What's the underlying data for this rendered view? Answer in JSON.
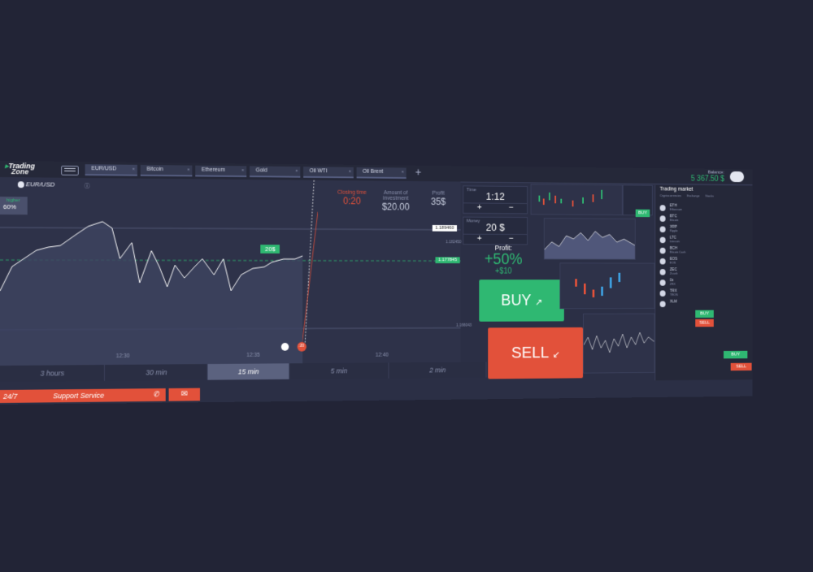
{
  "app": {
    "logo_line1": "Trading",
    "logo_line2": "Zone"
  },
  "tabs": [
    "EUR/USD",
    "Bitcoin",
    "Ethereum",
    "Gold",
    "Oil WTI",
    "Oil Brent"
  ],
  "balance": {
    "label": "Balance:",
    "value": "5 367.50 $"
  },
  "chart": {
    "pair": "EUR/USD",
    "direction_label": "higher",
    "direction_pct": "60%",
    "price_tags": [
      "1.189460",
      "1.182450",
      "1.177845",
      "1.166043"
    ],
    "marker": "20$",
    "time_labels": [
      "12:30",
      "12:35",
      "12:40"
    ],
    "countdown": ":20"
  },
  "stats": {
    "closing_label": "Closing time",
    "closing_value": "0:20",
    "investment_label": "Amount of investment",
    "investment_value": "$20.00",
    "profit_label": "Profit",
    "profit_value": "35$"
  },
  "controls": {
    "time_label": "Time",
    "time_value": "1:12",
    "money_label": "Money",
    "money_value": "20 $",
    "plus": "+",
    "minus": "−"
  },
  "profit": {
    "label": "Profit:",
    "percent": "+50%",
    "amount": "+$10"
  },
  "actions": {
    "buy": "BUY",
    "sell": "SELL"
  },
  "timeline": [
    "3 hours",
    "30 min",
    "15 min",
    "5 min",
    "2 min"
  ],
  "support": {
    "hours": "24/7",
    "label": "Support Service"
  },
  "market": {
    "title": "Trading market",
    "subtabs": [
      "Cryptocurrencies",
      "Exchange",
      "Stocks"
    ],
    "coins": [
      {
        "name": "ETH",
        "sub": "Ethereum"
      },
      {
        "name": "BTC",
        "sub": "Bitcoin"
      },
      {
        "name": "XRP",
        "sub": "Ripple"
      },
      {
        "name": "LTC",
        "sub": "Litecoin"
      },
      {
        "name": "BCH",
        "sub": "Bitcoin Cash"
      },
      {
        "name": "EOS",
        "sub": "EOS"
      },
      {
        "name": "ZEC",
        "sub": "Zcash"
      },
      {
        "name": "0x",
        "sub": "ZRX"
      },
      {
        "name": "TRX",
        "sub": "TRON"
      },
      {
        "name": "XLM",
        "sub": ""
      }
    ]
  },
  "mini": {
    "buy": "BUY",
    "sell": "SELL"
  },
  "colors": {
    "green": "#2fb872",
    "red": "#e2513a",
    "bg": "#222436",
    "panel": "#2b2f45"
  }
}
